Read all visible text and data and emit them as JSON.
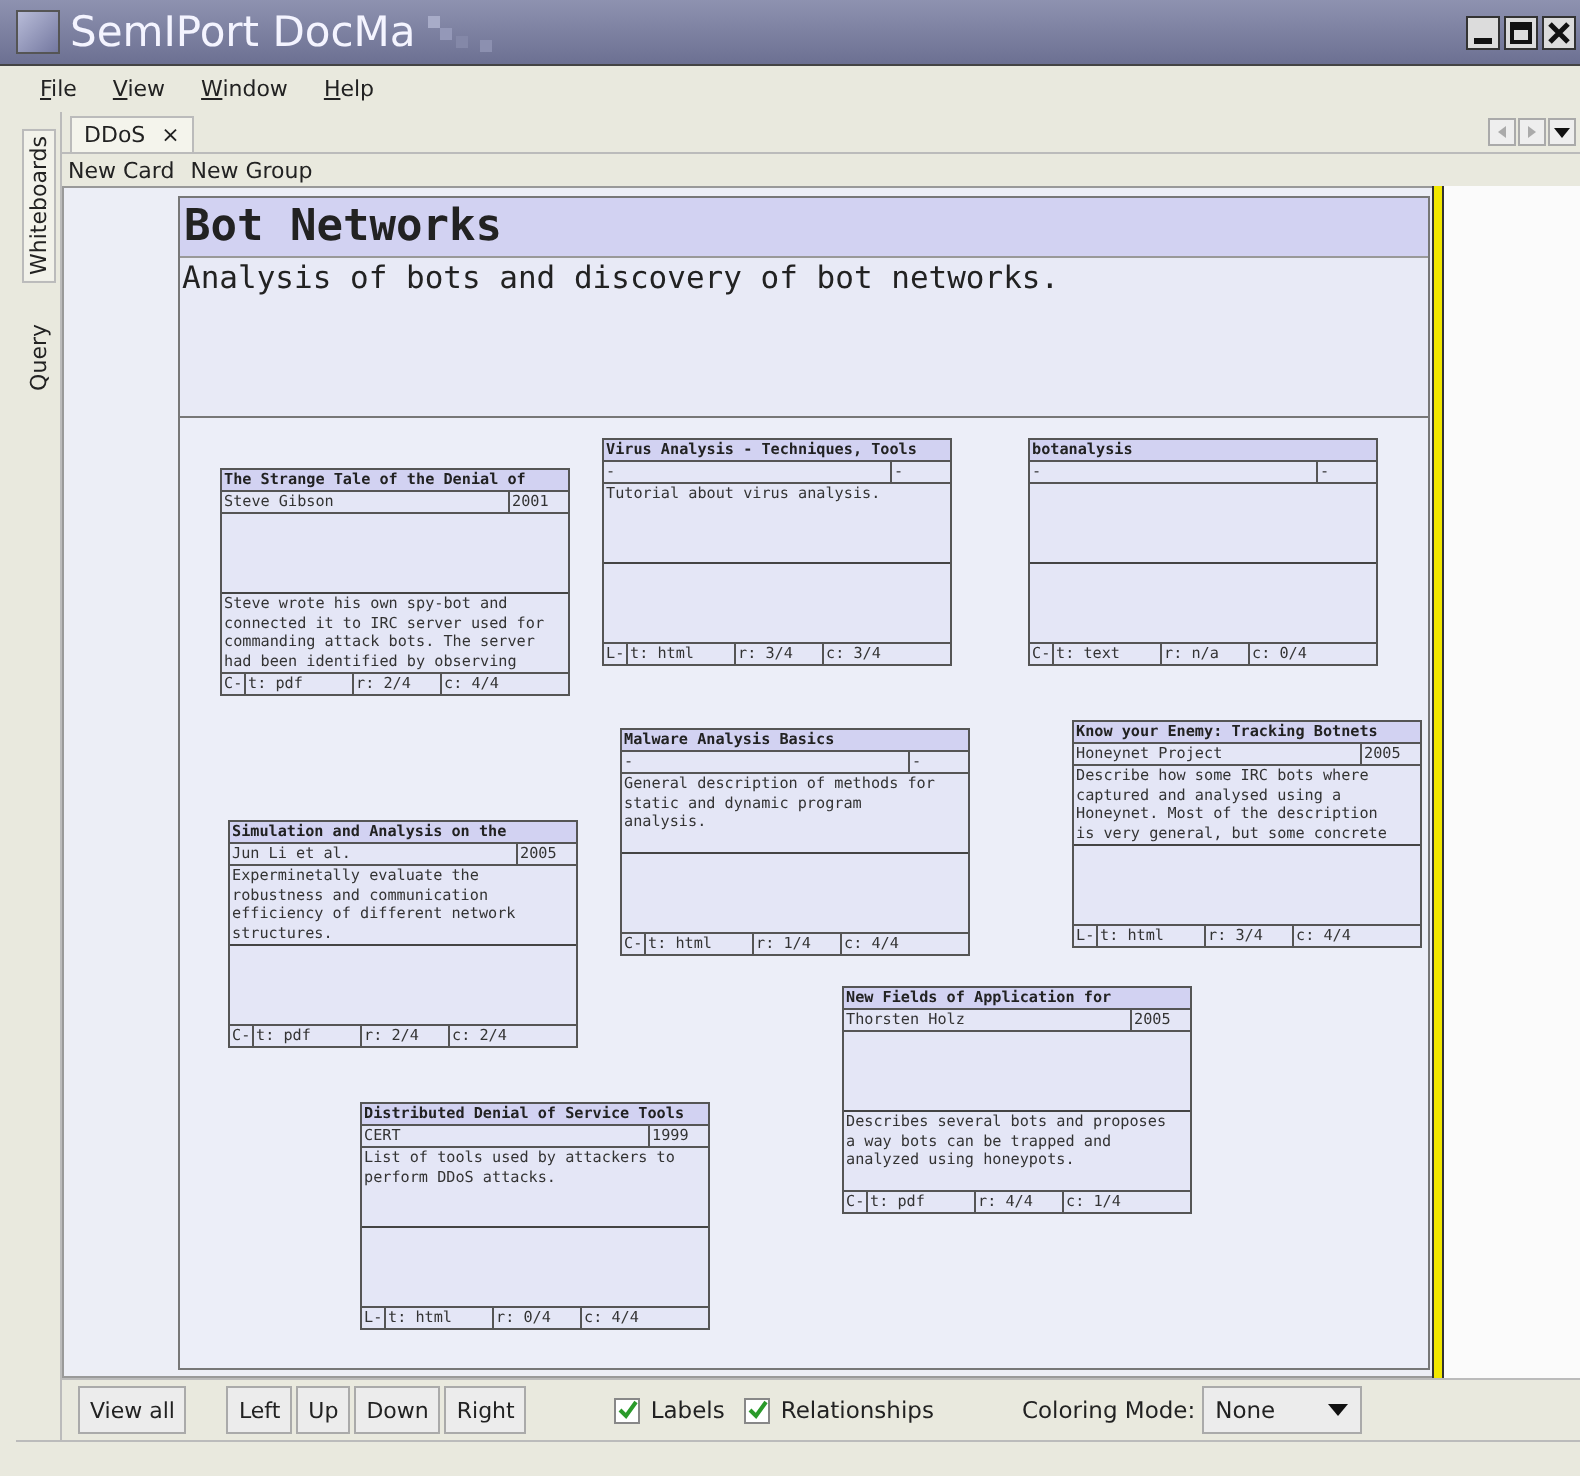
{
  "window": {
    "title": "SemIPort DocMa"
  },
  "menu": [
    "File",
    "View",
    "Window",
    "Help"
  ],
  "side_tabs": [
    {
      "label": "Whiteboards",
      "selected": true
    },
    {
      "label": "Query",
      "selected": false
    }
  ],
  "tabs": [
    {
      "label": "DDoS",
      "close": "×",
      "selected": true
    }
  ],
  "toolbar": [
    "New Card",
    "New Group"
  ],
  "group": {
    "title": "Bot Networks",
    "description": "Analysis of bots and discovery of bot networks."
  },
  "cards": [
    {
      "title": "The Strange Tale of the Denial of",
      "author": "Steve Gibson",
      "year": "2001",
      "lower_description": "Steve wrote his own spy-bot and\nconnected it to IRC server used for\ncommanding attack bots. The server\nhad been identified by observing",
      "link": "C-",
      "type": "t: pdf",
      "rating": "r: 2/4",
      "completeness": "c: 4/4"
    },
    {
      "title": "Virus Analysis - Techniques, Tools",
      "author": "-",
      "year": "-",
      "upper_description": "Tutorial about virus analysis.",
      "link": "L-",
      "type": "t: html",
      "rating": "r: 3/4",
      "completeness": "c: 3/4"
    },
    {
      "title": "botanalysis",
      "author": "-",
      "year": "-",
      "link": "C-",
      "type": "t: text",
      "rating": "r: n/a",
      "completeness": "c: 0/4"
    },
    {
      "title": "Malware Analysis Basics",
      "author": "-",
      "year": "-",
      "upper_description": "General description of methods for\nstatic and dynamic program\nanalysis.",
      "link": "C-",
      "type": "t: html",
      "rating": "r: 1/4",
      "completeness": "c: 4/4"
    },
    {
      "title": "Simulation and Analysis on the",
      "author": "Jun Li et al.",
      "year": "2005",
      "upper_description": "Experminetally evaluate the\nrobustness and communication\nefficiency of different network\nstructures.",
      "link": "C-",
      "type": "t: pdf",
      "rating": "r: 2/4",
      "completeness": "c: 2/4"
    },
    {
      "title": "Know your Enemy: Tracking Botnets",
      "author": "Honeynet Project",
      "year": "2005",
      "upper_description": "Describe how some IRC bots where\ncaptured and analysed using a\nHoneynet. Most of the description\nis very general, but some concrete",
      "link": "L-",
      "type": "t: html",
      "rating": "r: 3/4",
      "completeness": "c: 4/4"
    },
    {
      "title": "New Fields of Application for",
      "author": "Thorsten Holz",
      "year": "2005",
      "lower_description": "Describes several bots and proposes\na way bots can be trapped and\nanalyzed using honeypots.",
      "link": "C-",
      "type": "t: pdf",
      "rating": "r: 4/4",
      "completeness": "c: 1/4"
    },
    {
      "title": "Distributed Denial of Service Tools",
      "author": "CERT",
      "year": "1999",
      "upper_description": "List of tools used by attackers to\nperform DDoS attacks.",
      "link": "L-",
      "type": "t: html",
      "rating": "r: 0/4",
      "completeness": "c: 4/4"
    }
  ],
  "view_buttons": [
    "View all"
  ],
  "nav_buttons": [
    "Left",
    "Up",
    "Down",
    "Right"
  ],
  "checkboxes": [
    {
      "label": "Labels",
      "checked": true
    },
    {
      "label": "Relationships",
      "checked": true
    }
  ],
  "coloring_mode": {
    "label": "Coloring Mode:",
    "value": "None"
  }
}
